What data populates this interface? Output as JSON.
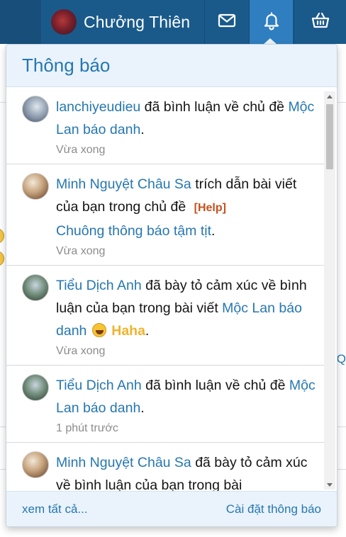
{
  "navbar": {
    "user_name": "Chưởng Thiên",
    "icons": {
      "inbox": "envelope-icon",
      "alerts": "bell-icon",
      "cart": "basket-icon"
    },
    "colors": {
      "bar": "#1a5a8b",
      "active": "#2f7ec0"
    }
  },
  "dropdown": {
    "title": "Thông báo",
    "notifications": [
      {
        "user": "lanchiyeudieu",
        "action": " đã bình luận về chủ đề ",
        "target": "Mộc Lan báo danh",
        "suffix": ".",
        "time": "Vừa xong"
      },
      {
        "user": "Minh Nguyệt Châu Sa",
        "action": " trích dẫn bài viết của bạn trong chủ đề ",
        "tag": "[Help]",
        "target": "Chuông thông báo tậm tịt",
        "suffix": ".",
        "time": "Vừa xong"
      },
      {
        "user": "Tiểu Dịch Anh",
        "action": " đã bày tỏ cảm xúc về bình luận của bạn trong bài viết ",
        "target": "Mộc Lan báo danh",
        "reaction_icon": "laughing-emoji-icon",
        "reaction": "Haha",
        "suffix": ".",
        "time": "Vừa xong"
      },
      {
        "user": "Tiểu Dịch Anh",
        "action": " đã bình luận về chủ đề ",
        "target": "Mộc Lan báo danh",
        "suffix": ".",
        "time": "1 phút trước"
      },
      {
        "user": "Minh Nguyệt Châu Sa",
        "action": " đã bày tỏ cảm xúc về bình luận của bạn trong bài"
      }
    ],
    "footer": {
      "see_all": "xem tất cả...",
      "settings": "Cài đặt thông báo"
    },
    "colors": {
      "link": "#2577b1",
      "tag": "#c4511e",
      "reaction": "#f0b32c",
      "header_bg": "#eaf3fb"
    }
  },
  "background": {
    "edge_text": "Q"
  }
}
